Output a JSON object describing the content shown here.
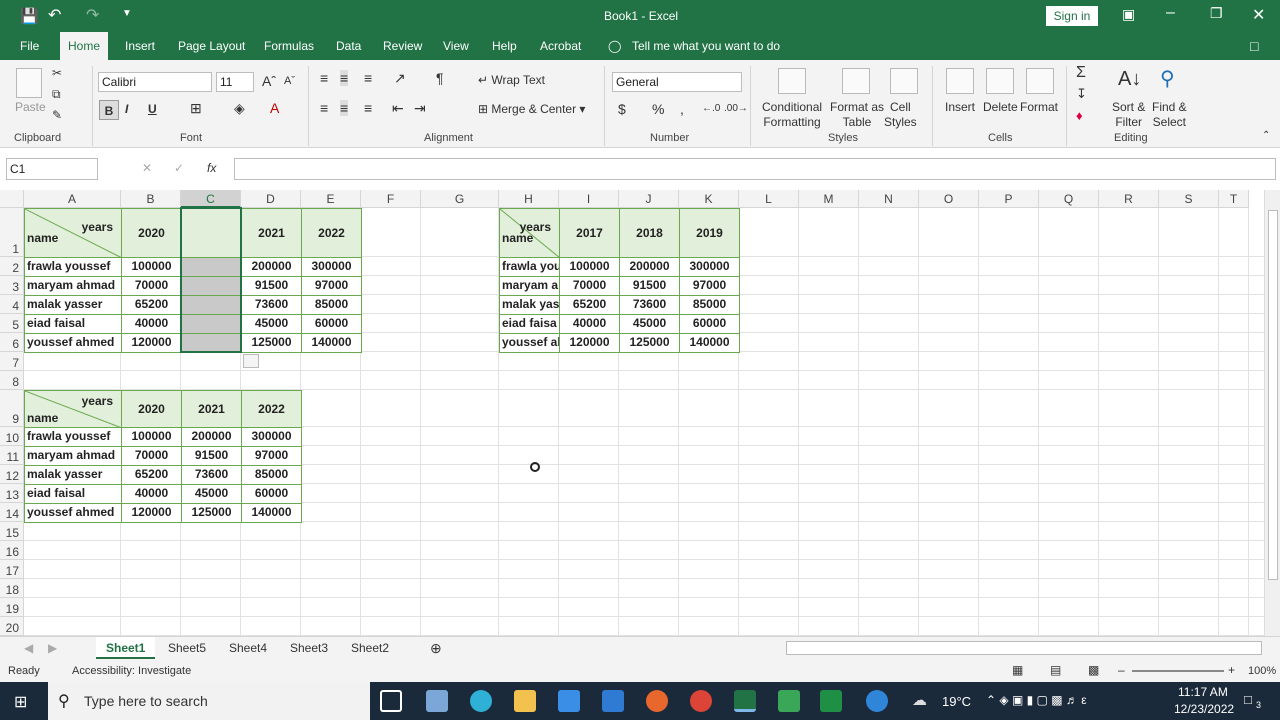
{
  "title_bar": {
    "title": "Book1 - Excel",
    "sign_in": "Sign in"
  },
  "ribbon_tabs": [
    "File",
    "Home",
    "Insert",
    "Page Layout",
    "Formulas",
    "Data",
    "Review",
    "View",
    "Help",
    "Acrobat"
  ],
  "active_tab": "Home",
  "tell_me": "Tell me what you want to do",
  "ribbon": {
    "clipboard": {
      "paste": "Paste",
      "group": "Clipboard"
    },
    "font": {
      "name": "Calibri",
      "size": "11",
      "bold": "B",
      "italic": "I",
      "underline": "U",
      "group": "Font"
    },
    "alignment": {
      "wrap": "Wrap Text",
      "merge": "Merge & Center",
      "group": "Alignment"
    },
    "number": {
      "format": "General",
      "currency": "$",
      "percent": "%",
      "comma": ",",
      "group": "Number"
    },
    "styles": {
      "cond1": "Conditional",
      "cond2": "Formatting",
      "fat1": "Format as",
      "fat2": "Table",
      "cs1": "Cell",
      "cs2": "Styles",
      "group": "Styles"
    },
    "cells": {
      "insert": "Insert",
      "delete": "Delete",
      "format": "Format",
      "group": "Cells"
    },
    "editing": {
      "sort1": "Sort &",
      "sort2": "Filter",
      "find1": "Find &",
      "find2": "Select",
      "group": "Editing"
    }
  },
  "name_box": "C1",
  "fx": "fx",
  "columns": [
    "A",
    "B",
    "C",
    "D",
    "E",
    "F",
    "G",
    "H",
    "I",
    "J",
    "K",
    "L",
    "M",
    "N",
    "O",
    "P",
    "Q",
    "R",
    "S",
    "T"
  ],
  "rows": [
    "1",
    "2",
    "3",
    "4",
    "5",
    "6",
    "7",
    "8",
    "9",
    "10",
    "11",
    "12",
    "13",
    "14",
    "15",
    "16",
    "17",
    "18",
    "19",
    "20"
  ],
  "table1": {
    "header_years": "years",
    "header_name": "name",
    "years": [
      "2020",
      "",
      "2021",
      "2022"
    ],
    "rows": [
      {
        "name": "frawla youssef",
        "values": [
          "100000",
          "",
          "200000",
          "300000"
        ]
      },
      {
        "name": "maryam ahmad",
        "values": [
          "70000",
          "",
          "91500",
          "97000"
        ]
      },
      {
        "name": "malak yasser",
        "values": [
          "65200",
          "",
          "73600",
          "85000"
        ]
      },
      {
        "name": "eiad faisal",
        "values": [
          "40000",
          "",
          "45000",
          "60000"
        ]
      },
      {
        "name": "youssef ahmed",
        "values": [
          "120000",
          "",
          "125000",
          "140000"
        ]
      }
    ]
  },
  "table2": {
    "header_years": "years",
    "header_name": "name",
    "years": [
      "2020",
      "2021",
      "2022"
    ],
    "rows": [
      {
        "name": "frawla youssef",
        "values": [
          "100000",
          "200000",
          "300000"
        ]
      },
      {
        "name": "maryam ahmad",
        "values": [
          "70000",
          "91500",
          "97000"
        ]
      },
      {
        "name": "malak yasser",
        "values": [
          "65200",
          "73600",
          "85000"
        ]
      },
      {
        "name": "eiad faisal",
        "values": [
          "40000",
          "45000",
          "60000"
        ]
      },
      {
        "name": "youssef ahmed",
        "values": [
          "120000",
          "125000",
          "140000"
        ]
      }
    ]
  },
  "table3": {
    "header_years": "years",
    "header_name": "name",
    "years": [
      "2017",
      "2018",
      "2019"
    ],
    "rows": [
      {
        "name": "frawla you",
        "values": [
          "100000",
          "200000",
          "300000"
        ]
      },
      {
        "name": "maryam a",
        "values": [
          "70000",
          "91500",
          "97000"
        ]
      },
      {
        "name": "malak yas",
        "values": [
          "65200",
          "73600",
          "85000"
        ]
      },
      {
        "name": "eiad faisa",
        "values": [
          "40000",
          "45000",
          "60000"
        ]
      },
      {
        "name": "youssef al",
        "values": [
          "120000",
          "125000",
          "140000"
        ]
      }
    ]
  },
  "sheet_tabs": [
    "Sheet1",
    "Sheet5",
    "Sheet4",
    "Sheet3",
    "Sheet2"
  ],
  "active_sheet": "Sheet1",
  "status": {
    "ready": "Ready",
    "accessibility": "Accessibility: Investigate",
    "zoom": "100%"
  },
  "taskbar": {
    "search": "Type here to search",
    "weather": "19°C",
    "time": "11:17 AM",
    "date": "12/23/2022",
    "notif": "3"
  },
  "colors": {
    "excel_green": "#217346",
    "table_header": "#e2efda",
    "table_border": "#6aa84f"
  }
}
